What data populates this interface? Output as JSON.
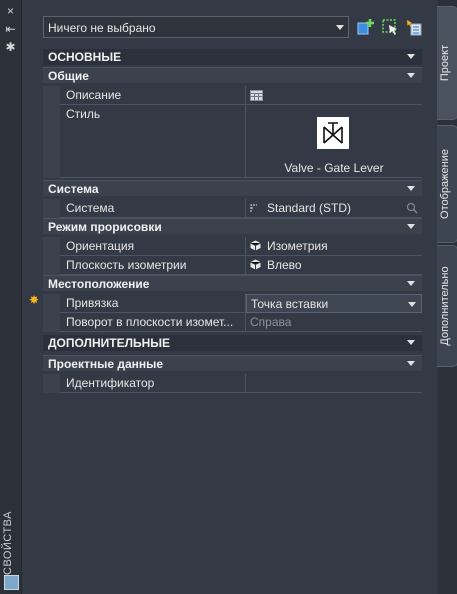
{
  "left_strip": {
    "close_icon": "×",
    "pin_icon": "⇤",
    "settings_icon": "✱",
    "title": "СВОЙСТВА"
  },
  "selector": {
    "value": "Ничего не выбрано"
  },
  "tabs": [
    {
      "label": "Проект"
    },
    {
      "label": "Отображение"
    },
    {
      "label": "Дополнительно"
    }
  ],
  "sections": {
    "basic": "ОСНОВНЫЕ",
    "general": "Общие",
    "system": "Система",
    "draw_mode": "Режим прорисовки",
    "location": "Местоположение",
    "additional": "ДОПОЛНИТЕЛЬНЫЕ",
    "project_data": "Проектные данные"
  },
  "props": {
    "description": {
      "label": "Описание",
      "value": ""
    },
    "style": {
      "label": "Стиль",
      "value": "Valve - Gate Lever"
    },
    "system": {
      "label": "Система",
      "value": "Standard (STD)"
    },
    "orientation": {
      "label": "Ориентация",
      "value": "Изометрия"
    },
    "iso_plane": {
      "label": "Плоскость изометрии",
      "value": "Влево"
    },
    "snap": {
      "label": "Привязка",
      "value": "Точка вставки"
    },
    "rotation": {
      "label": "Поворот в плоскости изомет...",
      "value": "Справа"
    },
    "identifier": {
      "label": "Идентификатор",
      "value": ""
    }
  },
  "colors": {
    "accent": "#f5b51d",
    "panel": "#343a45",
    "header": "#2b303a"
  }
}
